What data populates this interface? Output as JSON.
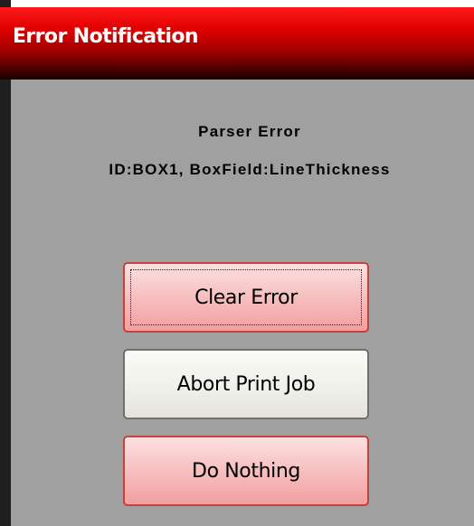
{
  "window": {
    "title": "Error Notification"
  },
  "message": {
    "title": "Parser Error",
    "detail": "ID:BOX1, BoxField:LineThickness"
  },
  "buttons": [
    {
      "label": "Clear Error",
      "style": "red",
      "focused": true
    },
    {
      "label": "Abort Print Job",
      "style": "grey",
      "focused": false
    },
    {
      "label": "Do Nothing",
      "style": "red",
      "focused": false
    }
  ],
  "colors": {
    "title_bar_accent": "#e00000",
    "content_background": "#a0a0a0",
    "red_button_fill": "#f7bcbc",
    "red_button_border": "#c94040",
    "grey_button_fill": "#f0f0ea"
  }
}
